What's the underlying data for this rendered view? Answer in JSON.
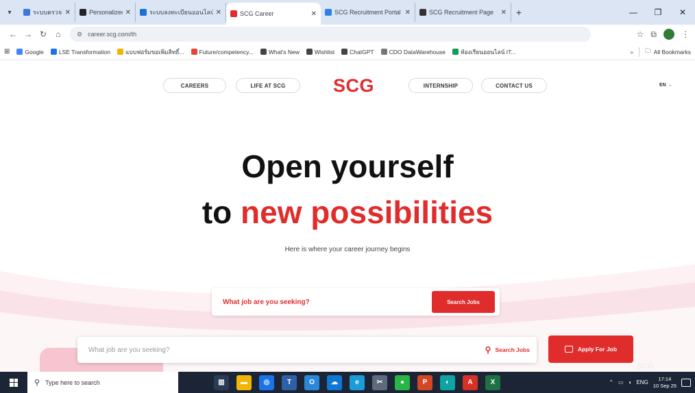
{
  "browser": {
    "tabs": [
      {
        "title": "ระบบตรวจสอบข้อมูล",
        "color": "#3c78d8",
        "active": false
      },
      {
        "title": "Personalized Lifelong",
        "color": "#222222",
        "active": false
      },
      {
        "title": "ระบบลงทะเบียนออนไลน์",
        "color": "#1e6fd9",
        "active": false
      },
      {
        "title": "SCG Career",
        "color": "#e12c2c",
        "active": true
      },
      {
        "title": "SCG Recruitment Portal",
        "color": "#2f80ed",
        "active": false
      },
      {
        "title": "SCG Recruitment Page",
        "color": "#333333",
        "active": false
      }
    ],
    "new_tab_symbol": "+",
    "address": "career.scg.com/th",
    "bookmarks": [
      {
        "label": "Google",
        "color": "#4285f4"
      },
      {
        "label": "LSE Transformation",
        "color": "#1a73e8"
      },
      {
        "label": "แบบฟอร์มขอเพิ่มสิทธิ์...",
        "color": "#f4b400"
      },
      {
        "label": "Future/competency...",
        "color": "#ea4335"
      },
      {
        "label": "What's New",
        "color": "#444444"
      },
      {
        "label": "Wishlist",
        "color": "#444444"
      },
      {
        "label": "ChatGPT",
        "color": "#444444"
      },
      {
        "label": "CDO DataWarehouse",
        "color": "#777777"
      },
      {
        "label": "ห้องเรียนออนไลน์ IT...",
        "color": "#0f9d58"
      }
    ],
    "bookmarks_more": "»",
    "all_bookmarks": "All Bookmarks"
  },
  "nav": {
    "careers": "CAREERS",
    "life_at_scg": "LIFE AT SCG",
    "logo": "SCG",
    "internship": "INTERNSHIP",
    "contact_us": "CONTACT US",
    "lang": "EN"
  },
  "hero": {
    "line1": "Open yourself",
    "line2_prefix": "to",
    "line2_highlight": "new possibilities",
    "subtitle": "Here is where your career journey begins"
  },
  "search_primary": {
    "placeholder": "What job are you seeking?",
    "button": "Search Jobs"
  },
  "search_sticky": {
    "placeholder": "What job are you seeking?",
    "search_link": "Search Jobs",
    "apply_button": "Apply For Job"
  },
  "faint_logo": "SCG",
  "taskbar": {
    "search_placeholder": "Type here to search",
    "time": "17:14",
    "date": "10 Sep 25",
    "lang": "ENG"
  },
  "colors": {
    "brand_red": "#e12c2c",
    "taskbar": "#1c2536",
    "tabstrip": "#dbe5f3"
  }
}
